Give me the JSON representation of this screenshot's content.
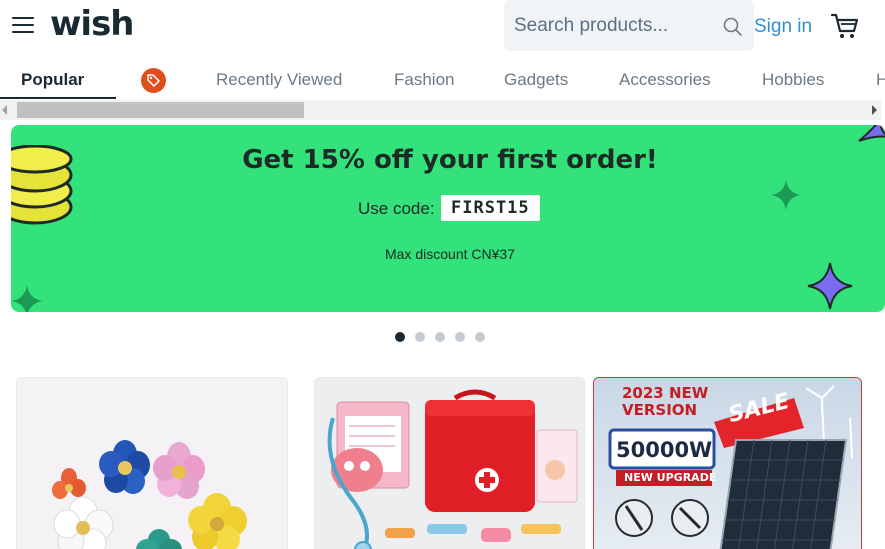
{
  "header": {
    "logo_text": "wish",
    "search_placeholder": "Search products...",
    "signin_label": "Sign in"
  },
  "tabs": [
    {
      "label": "Popular",
      "active": true
    },
    {
      "label": "",
      "icon": "price-tag-icon"
    },
    {
      "label": "Recently Viewed"
    },
    {
      "label": "Fashion"
    },
    {
      "label": "Gadgets"
    },
    {
      "label": "Accessories"
    },
    {
      "label": "Hobbies"
    },
    {
      "label": "H"
    }
  ],
  "banner": {
    "title": "Get 15% off your first order!",
    "code_label": "Use code:",
    "code": "FIRST15",
    "max_discount": "Max discount CN¥37",
    "background_color": "#33e27a"
  },
  "carousel": {
    "dot_count": 5,
    "active_index": 0
  },
  "products": [
    {
      "name": "flower-earrings",
      "image": "colorful-flower-earrings-image"
    },
    {
      "name": "toy-doctor-kit",
      "image": "red-doctor-kit-toy-image"
    },
    {
      "name": "solar-panel",
      "image": "solar-panel-image",
      "badge_line1": "2023 NEW",
      "badge_line2": "VERSION",
      "sale_label": "SALE",
      "wattage": "50000W",
      "upgrade_label": "NEW UPGRADE"
    }
  ],
  "colors": {
    "accent_blue": "#2f8fd6",
    "text_dark": "#192a32",
    "tag_orange": "#e04e1b"
  }
}
